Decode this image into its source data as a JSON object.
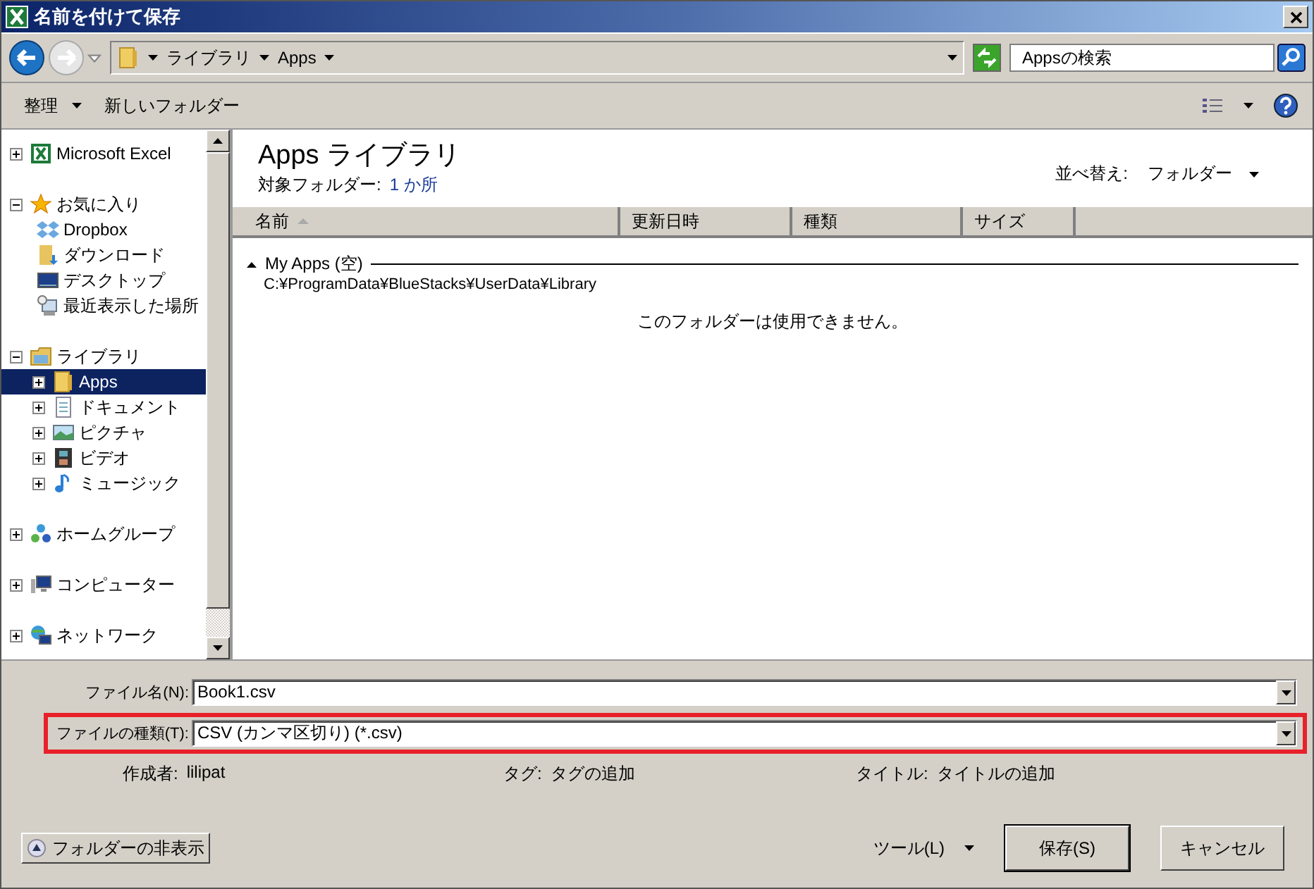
{
  "window": {
    "title": "名前を付けて保存"
  },
  "address_bar": {
    "crumbs": [
      "ライブラリ",
      "Apps"
    ]
  },
  "search": {
    "placeholder": "Appsの検索"
  },
  "toolbar": {
    "organize": "整理",
    "new_folder": "新しいフォルダー"
  },
  "sidebar": {
    "items": [
      {
        "label": "Microsoft Excel",
        "kind": "excel",
        "expanded": false,
        "selected": false
      },
      {
        "label": "お気に入り",
        "kind": "star",
        "expanded": true,
        "selected": false,
        "children": [
          {
            "label": "Dropbox",
            "kind": "dropbox",
            "selected": false
          },
          {
            "label": "ダウンロード",
            "kind": "download",
            "selected": false
          },
          {
            "label": "デスクトップ",
            "kind": "desktop",
            "selected": false
          },
          {
            "label": "最近表示した場所",
            "kind": "recent",
            "selected": false
          }
        ]
      },
      {
        "label": "ライブラリ",
        "kind": "library",
        "expanded": true,
        "selected": false,
        "children": [
          {
            "label": "Apps",
            "kind": "folder",
            "expanded": false,
            "selected": true
          },
          {
            "label": "ドキュメント",
            "kind": "document",
            "expanded": false,
            "selected": false
          },
          {
            "label": "ピクチャ",
            "kind": "picture",
            "expanded": false,
            "selected": false
          },
          {
            "label": "ビデオ",
            "kind": "video",
            "expanded": false,
            "selected": false
          },
          {
            "label": "ミュージック",
            "kind": "music",
            "expanded": false,
            "selected": false
          }
        ]
      },
      {
        "label": "ホームグループ",
        "kind": "homegroup",
        "expanded": false,
        "selected": false
      },
      {
        "label": "コンピューター",
        "kind": "computer",
        "expanded": false,
        "selected": false
      },
      {
        "label": "ネットワーク",
        "kind": "network",
        "expanded": false,
        "selected": false
      }
    ]
  },
  "library": {
    "title": "Apps ライブラリ",
    "subtitle_label": "対象フォルダー:",
    "subtitle_link": "1 か所",
    "sort_label": "並べ替え:",
    "sort_value": "フォルダー"
  },
  "table": {
    "columns": [
      {
        "label": "名前",
        "sorted": true
      },
      {
        "label": "更新日時",
        "sorted": false
      },
      {
        "label": "種類",
        "sorted": false
      },
      {
        "label": "サイズ",
        "sorted": false
      }
    ],
    "group": {
      "label": "My Apps (空)",
      "expanded": true,
      "path": "C:¥ProgramData¥BlueStacks¥UserData¥Library"
    },
    "empty_message": "このフォルダーは使用できません。"
  },
  "fields": [
    {
      "label": "ファイル名(N):",
      "value": "Book1.csv",
      "highlighted": false
    },
    {
      "label": "ファイルの種類(T):",
      "value": "CSV (カンマ区切り) (*.csv)",
      "highlighted": true
    }
  ],
  "metadata": [
    {
      "label": "作成者:",
      "value": "lilipat"
    },
    {
      "label": "タグ:",
      "value": "タグの追加"
    },
    {
      "label": "タイトル:",
      "value": "タイトルの追加"
    }
  ],
  "buttons": {
    "hide_folders": "フォルダーの非表示",
    "tools": "ツール(L)",
    "save": "保存(S)",
    "cancel": "キャンセル"
  }
}
